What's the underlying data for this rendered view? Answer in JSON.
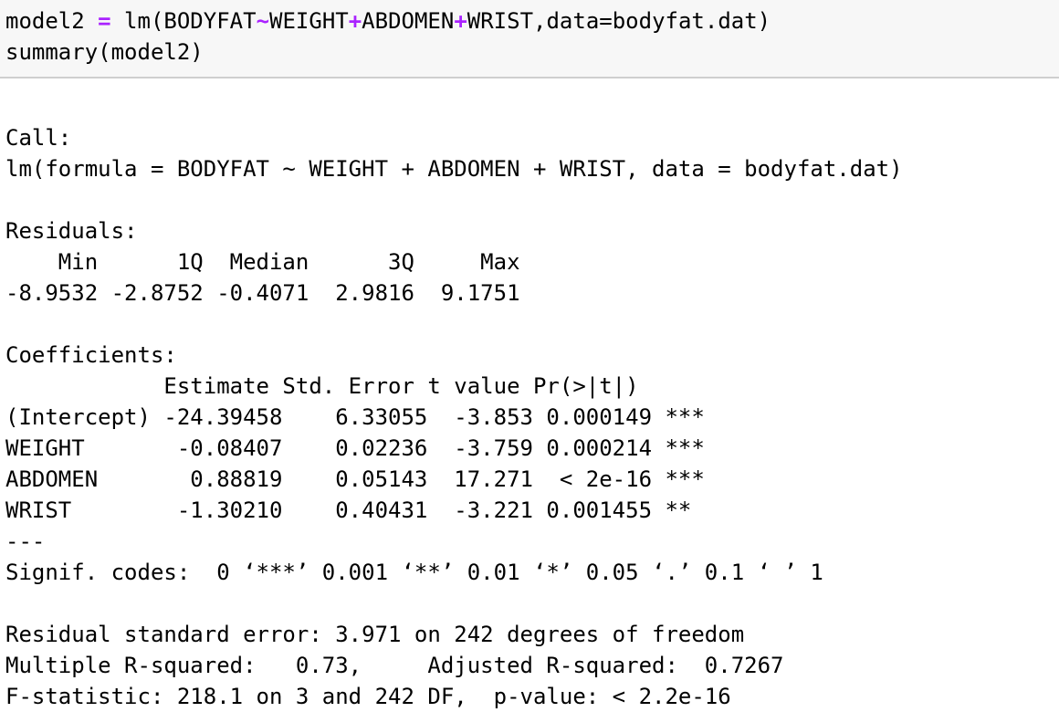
{
  "input": {
    "line1": {
      "part1": "model2 ",
      "assign_op": "=",
      "part2": " lm(BODYFAT",
      "tilde_op": "~",
      "part3": "WEIGHT",
      "plus_op1": "+",
      "part4": "ABDOMEN",
      "plus_op2": "+",
      "part5": "WRIST,data=bodyfat.dat)"
    },
    "line2": "summary(model2)"
  },
  "output": {
    "call_header": "Call:",
    "call_text": "lm(formula = BODYFAT ~ WEIGHT + ABDOMEN + WRIST, data = bodyfat.dat)",
    "residuals_header": "Residuals:",
    "residuals_labels": "    Min      1Q  Median      3Q     Max ",
    "residuals_values": "-8.9532 -2.8752 -0.4071  2.9816  9.1751 ",
    "coefficients_header": "Coefficients:",
    "coef_header_row": "            Estimate Std. Error t value Pr(>|t|)    ",
    "coef_rows": [
      "(Intercept) -24.39458    6.33055  -3.853 0.000149 ***",
      "WEIGHT       -0.08407    0.02236  -3.759 0.000214 ***",
      "ABDOMEN       0.88819    0.05143  17.271  < 2e-16 ***",
      "WRIST        -1.30210    0.40431  -3.221 0.001455 ** "
    ],
    "separator": "---",
    "signif_codes": "Signif. codes:  0 ‘***’ 0.001 ‘**’ 0.01 ‘*’ 0.05 ‘.’ 0.1 ‘ ’ 1",
    "rse": "Residual standard error: 3.971 on 242 degrees of freedom",
    "r_squared": "Multiple R-squared:   0.73,\tAdjusted R-squared:  0.7267 ",
    "f_stat": "F-statistic: 218.1 on 3 and 242 DF,  p-value: < 2.2e-16"
  }
}
